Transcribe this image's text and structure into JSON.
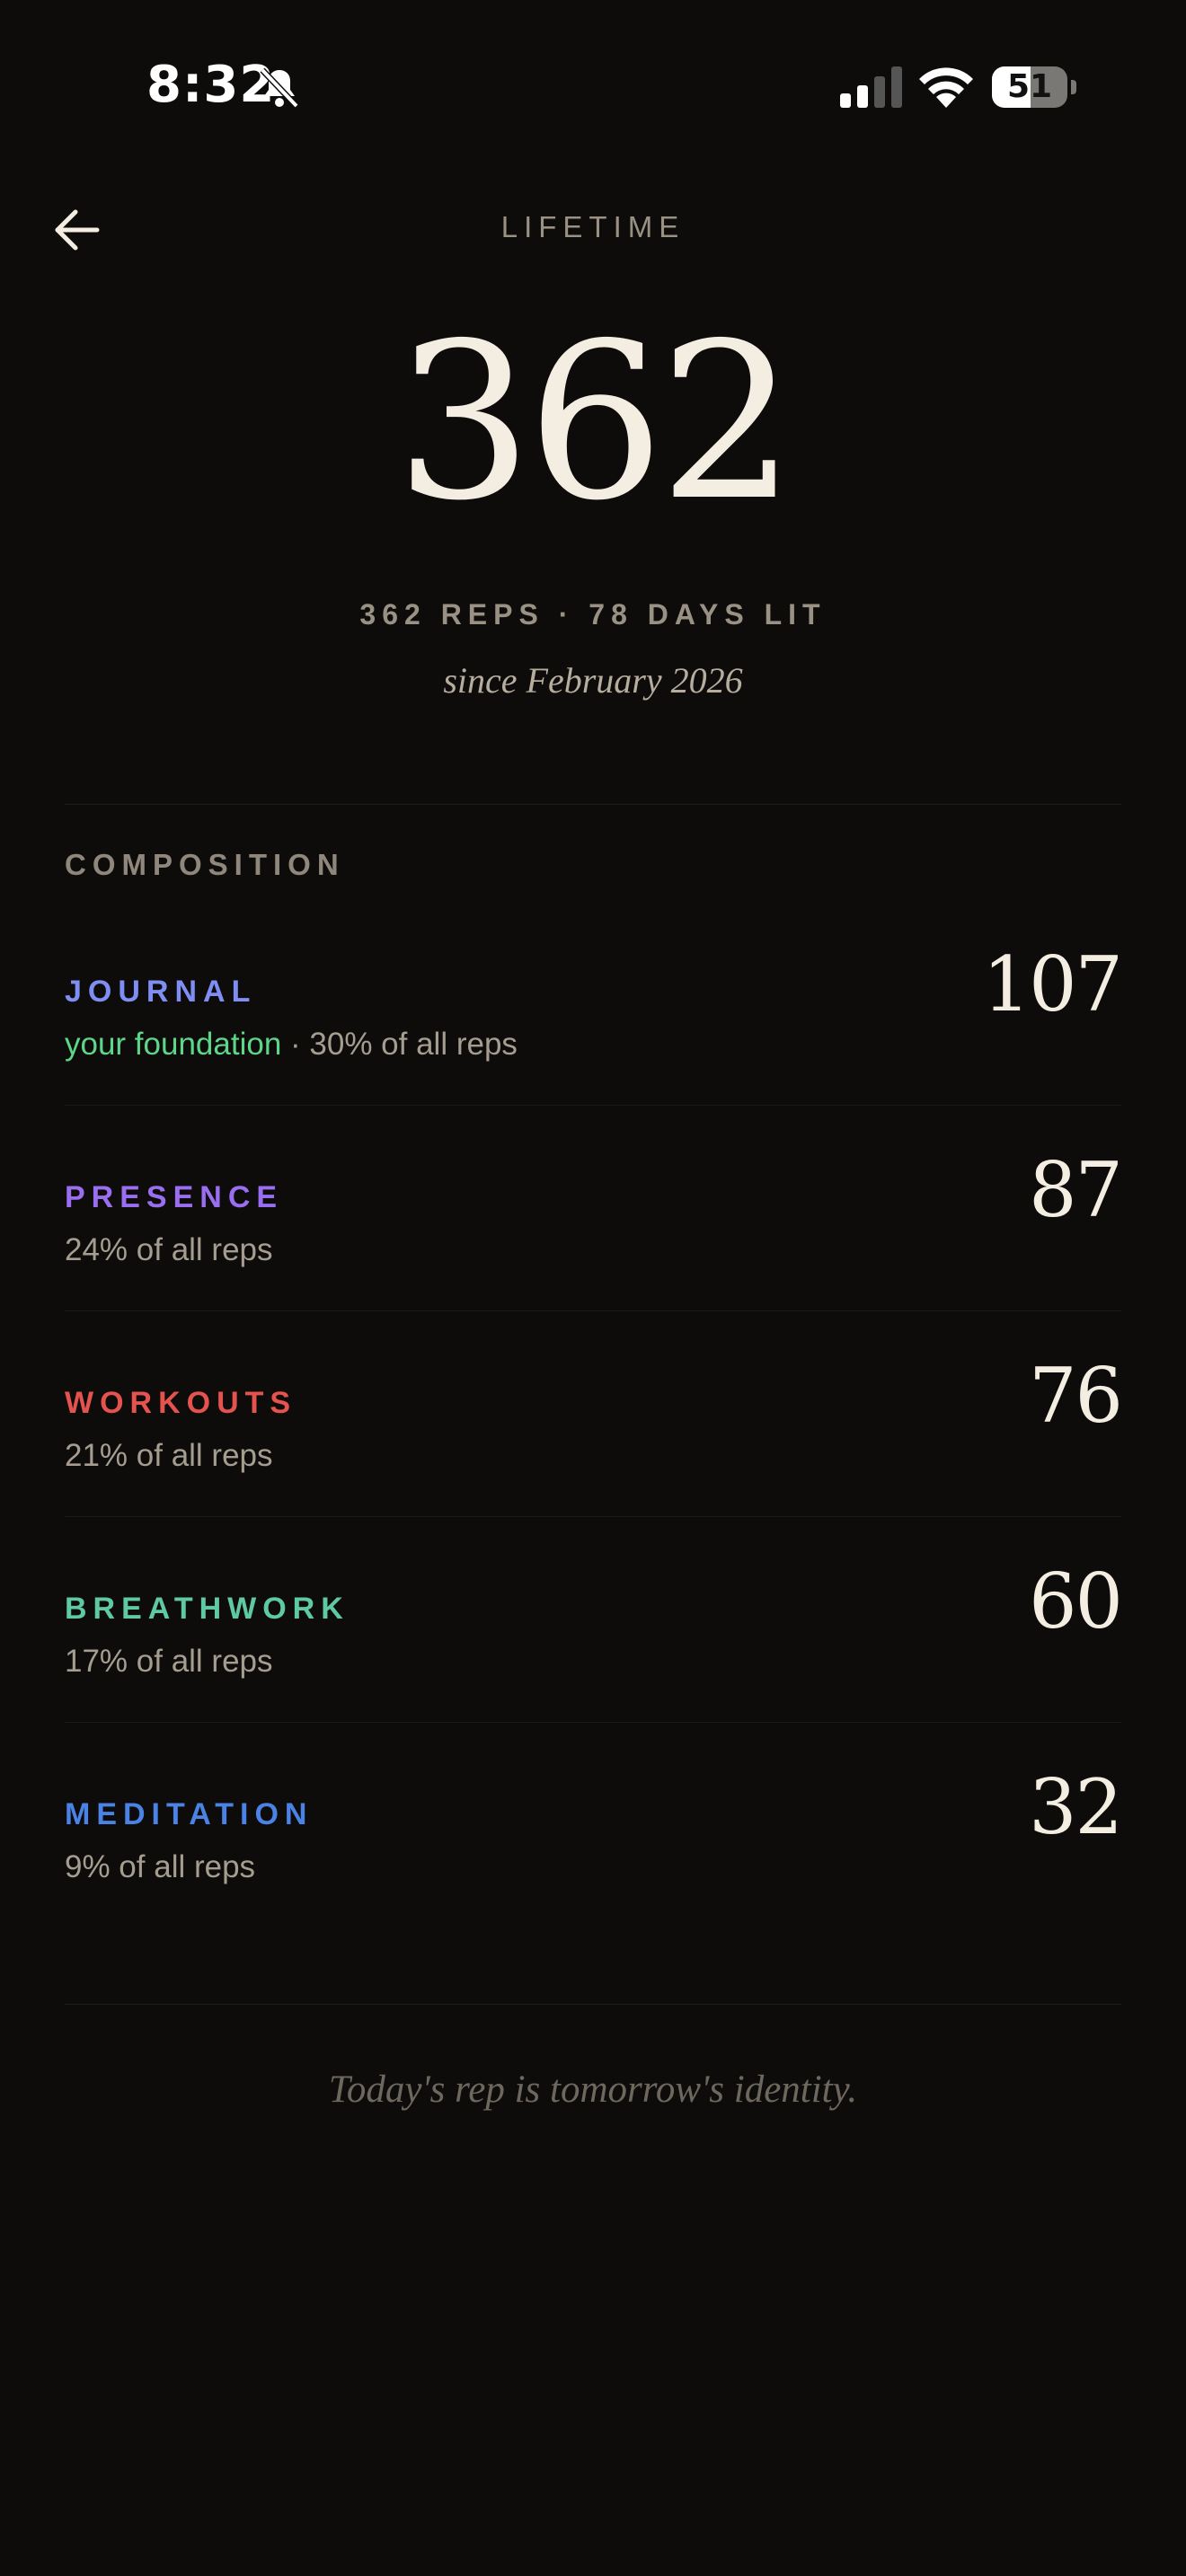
{
  "status_bar": {
    "time": "8:32",
    "battery_level": "51",
    "battery_fraction": 0.51,
    "icons": [
      "bell-slash-icon",
      "cellular-signal-icon",
      "wifi-icon",
      "battery-icon"
    ]
  },
  "header": {
    "back_icon": "arrow-left-icon",
    "title": "LIFETIME"
  },
  "summary": {
    "total": "362",
    "subtitle": "362 REPS · 78 DAYS LIT",
    "since": "since February 2026"
  },
  "composition": {
    "label": "COMPOSITION",
    "items": [
      {
        "name": "JOURNAL",
        "color": "#7f8ef2",
        "accent": "your foundation",
        "desc": " · 30% of all reps",
        "count": "107"
      },
      {
        "name": "PRESENCE",
        "color": "#9a6ef0",
        "accent": "",
        "desc": "24% of all reps",
        "count": "87"
      },
      {
        "name": "WORKOUTS",
        "color": "#e5534f",
        "accent": "",
        "desc": "21% of all reps",
        "count": "76"
      },
      {
        "name": "BREATHWORK",
        "color": "#5ec9a2",
        "accent": "",
        "desc": "17% of all reps",
        "count": "60"
      },
      {
        "name": "MEDITATION",
        "color": "#4a82e6",
        "accent": "",
        "desc": "9% of all reps",
        "count": "32"
      }
    ]
  },
  "footer": {
    "quote": "Today's rep is tomorrow's identity."
  }
}
